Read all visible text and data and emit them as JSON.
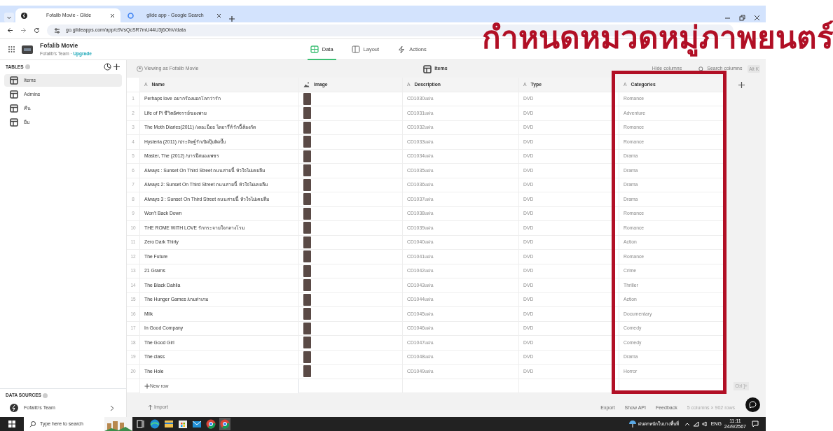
{
  "browser": {
    "tabs": [
      {
        "title": "Fofalib Movie - Glide",
        "selected": true
      },
      {
        "title": "glide app - Google Search",
        "selected": false
      }
    ],
    "url": "go.glideapps.com/app/c9VsQcSR7mU44U3j6OhV/data"
  },
  "app": {
    "name": "Fofalib Movie",
    "team": "Fofalib's Team · ",
    "upgrade": "Upgrade"
  },
  "nav_tabs": [
    {
      "label": "Data",
      "selected": true
    },
    {
      "label": "Layout",
      "selected": false
    },
    {
      "label": "Actions",
      "selected": false
    }
  ],
  "sidebar": {
    "heading": "TABLES",
    "tables": [
      {
        "label": "Items",
        "selected": true
      },
      {
        "label": "Admins",
        "selected": false
      },
      {
        "label": "คืน",
        "selected": false
      },
      {
        "label": "ยืม",
        "selected": false
      }
    ],
    "sources_heading": "DATA SOURCES",
    "source": "Fofalib's Team"
  },
  "toolbar": {
    "viewing_as": "Viewing as Fofalib Movie",
    "table_title": "Items",
    "hide_columns": "Hide columns",
    "search_placeholder": "Search columns",
    "search_shortcut": "Alt K"
  },
  "table": {
    "columns": [
      {
        "label": "Name",
        "kind": "text",
        "type_icon": "A"
      },
      {
        "label": "Image",
        "kind": "image"
      },
      {
        "label": "Description",
        "kind": "text",
        "type_icon": "A"
      },
      {
        "label": "Type",
        "kind": "text",
        "type_icon": "A"
      },
      {
        "label": "Categories",
        "kind": "text",
        "type_icon": "A"
      }
    ],
    "rows": [
      {
        "number": "1",
        "name": "Perhaps love อยากร้องบอกโลกว่ารัก",
        "description": "CD1030แผ่น",
        "type": "DVD",
        "category": "Romance"
      },
      {
        "number": "2",
        "name": "Life of Pi ชีวิตอัศจรรย์ของพาย",
        "description": "CD1031แผ่น",
        "type": "DVD",
        "category": "Adventure"
      },
      {
        "number": "3",
        "name": "The Moth Diaries(2011) /เดอะม็อธ ไดอารี่ส์ รักนี้ต้องกัด",
        "description": "CD1032แผ่น",
        "type": "DVD",
        "category": "Romance"
      },
      {
        "number": "4",
        "name": "Hysteria (2011) /ประดิษฐ์รักเปิดปุ๊บติดปั๊บ",
        "description": "CD1033แผ่น",
        "type": "DVD",
        "category": "Romance"
      },
      {
        "number": "5",
        "name": "Master, The (2012) /บารมีสมองเพชร",
        "description": "CD1034แผ่น",
        "type": "DVD",
        "category": "Drama"
      },
      {
        "number": "6",
        "name": "Always : Sunset On Third Street ถนนสายนี้ หัวใจไม่เคยลืม",
        "description": "CD1035แผ่น",
        "type": "DVD",
        "category": "Drama"
      },
      {
        "number": "7",
        "name": "Always 2: Sunset On Third Street ถนนสายนี้ หัวใจไม่เคยลืม",
        "description": "CD1036แผ่น",
        "type": "DVD",
        "category": "Drama"
      },
      {
        "number": "8",
        "name": "Always 3 : Sunset On Third Street ถนนสายนี้ หัวใจไม่เคยลืม",
        "description": "CD1037แผ่น",
        "type": "DVD",
        "category": "Drama"
      },
      {
        "number": "9",
        "name": "Won't Back Down",
        "description": "CD1038แผ่น",
        "type": "DVD",
        "category": "Romance"
      },
      {
        "number": "10",
        "name": "THE ROME WITH LOVE รักกระจายใจกลางโรม",
        "description": "CD1039แผ่น",
        "type": "DVD",
        "category": "Romance"
      },
      {
        "number": "11",
        "name": "Zero Dark Thirty",
        "description": "CD1040แผ่น",
        "type": "DVD",
        "category": "Action"
      },
      {
        "number": "12",
        "name": "The Future",
        "description": "CD1041แผ่น",
        "type": "DVD",
        "category": "Romance"
      },
      {
        "number": "13",
        "name": "21 Grams",
        "description": "CD1042แผ่น",
        "type": "DVD",
        "category": "Crime"
      },
      {
        "number": "14",
        "name": "The Black Dahlia",
        "description": "CD1043แผ่น",
        "type": "DVD",
        "category": "Thriller"
      },
      {
        "number": "15",
        "name": "The Hunger Games /เกมล่าเกม",
        "description": "CD1044แผ่น",
        "type": "DVD",
        "category": "Action"
      },
      {
        "number": "16",
        "name": "Milk",
        "description": "CD1045แผ่น",
        "type": "DVD",
        "category": "Documentary"
      },
      {
        "number": "17",
        "name": "In Good Company",
        "description": "CD1046แผ่น",
        "type": "DVD",
        "category": "Comedy"
      },
      {
        "number": "18",
        "name": "The Good Girl",
        "description": "CD1047แผ่น",
        "type": "DVD",
        "category": "Comedy"
      },
      {
        "number": "19",
        "name": "The class",
        "description": "CD1048แผ่น",
        "type": "DVD",
        "category": "Drama"
      },
      {
        "number": "20",
        "name": "The Hole",
        "description": "CD1049แผ่น",
        "type": "DVD",
        "category": "Horror"
      }
    ],
    "new_row": "New row",
    "shortcut": "Ctrl ]+"
  },
  "footer": {
    "import": "Import",
    "links": [
      "Export",
      "Show API",
      "Feedback"
    ],
    "summary": "5 columns × 902 rows"
  },
  "taskbar": {
    "search_placeholder": "Type here to search",
    "weather": "ฝนตกหนักในบางพื้นที่",
    "language": "ENG",
    "time": "11:11",
    "date": "24/9/2567"
  },
  "annotation": {
    "title": "กำหนดหมวดหมู่ภาพยนตร์"
  }
}
